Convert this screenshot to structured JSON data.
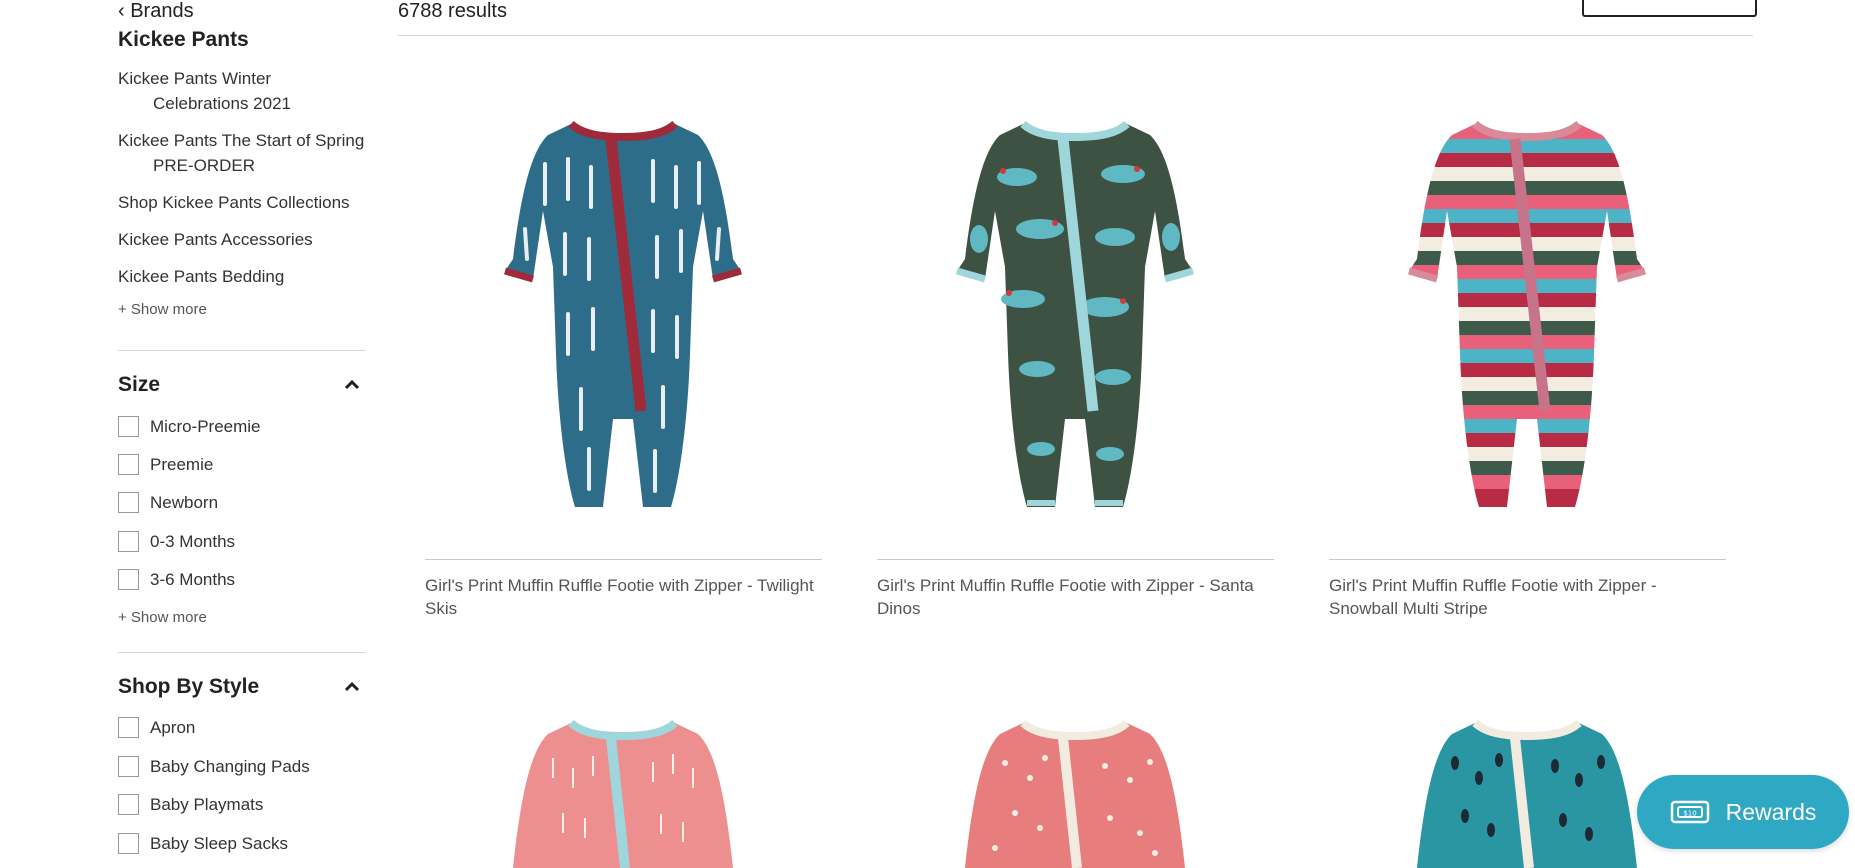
{
  "sidebar": {
    "back_link": "‹ Brands",
    "brand_title": "Kickee Pants",
    "sub_links": [
      "Kickee Pants Winter Celebrations 2021",
      "Kickee Pants The Start of Spring PRE-ORDER",
      "Shop Kickee Pants Collections",
      "Kickee Pants Accessories",
      "Kickee Pants Bedding"
    ],
    "show_more": "+ Show more",
    "size": {
      "title": "Size",
      "options": [
        "Micro-Preemie",
        "Preemie",
        "Newborn",
        "0-3 Months",
        "3-6 Months"
      ],
      "show_more": "+ Show more"
    },
    "style": {
      "title": "Shop By Style",
      "options": [
        "Apron",
        "Baby Changing Pads",
        "Baby Playmats",
        "Baby Sleep Sacks"
      ]
    }
  },
  "main": {
    "results": "6788 results",
    "products": [
      {
        "title": "Girl's Print Muffin Ruffle Footie with Zipper - Twilight Skis"
      },
      {
        "title": "Girl's Print Muffin Ruffle Footie with Zipper - Santa Dinos"
      },
      {
        "title": "Girl's Print Muffin Ruffle Footie with Zipper - Snowball Multi Stripe"
      }
    ]
  },
  "rewards": {
    "label": "Rewards",
    "icon": "ticket-icon"
  },
  "colors": {
    "accent": "#2fa8c4",
    "ski_body": "#2e6d8a",
    "ski_trim": "#9e2a3a",
    "dino_body": "#3e5244",
    "dino_trim": "#9fd6dc",
    "stripe_trim": "#d88a98",
    "pink_body": "#ee8f8f",
    "coral_body": "#e77d7d",
    "teal_body": "#2b96a3"
  }
}
